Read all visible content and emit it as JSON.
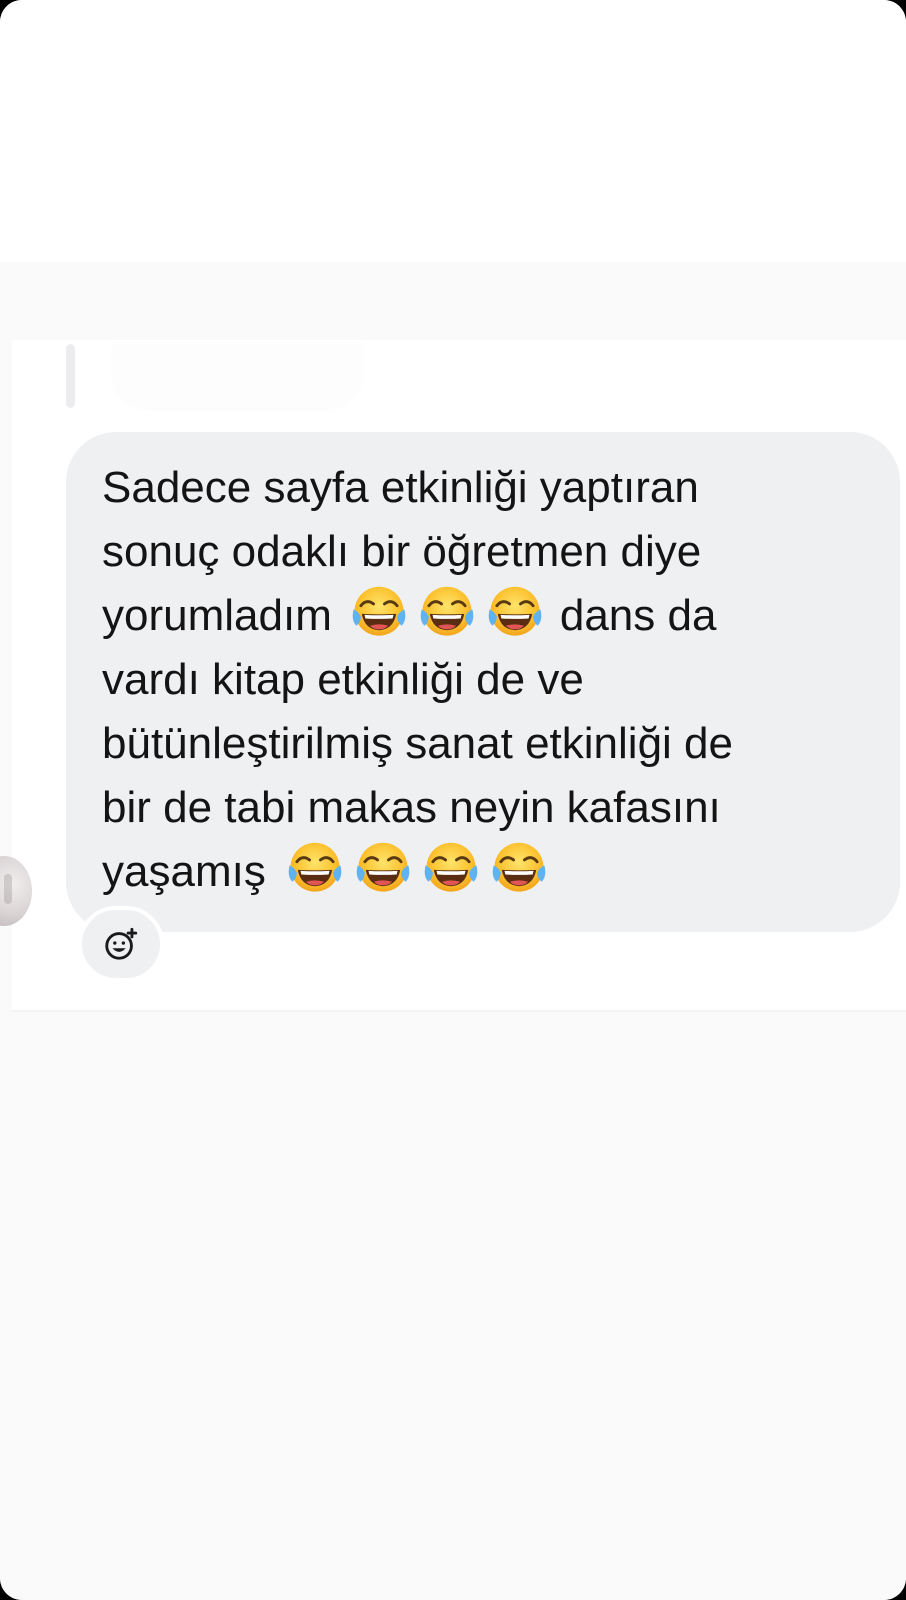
{
  "message": {
    "lines": [
      {
        "text": "Sadece sayfa etkinliği yaptıran",
        "emojis_after": []
      },
      {
        "text": "sonuç odaklı bir öğretmen diye",
        "emojis_after": []
      },
      {
        "text": "yorumladım",
        "emojis_after": [
          "face-with-tears-of-joy-emoji",
          "face-with-tears-of-joy-emoji",
          "face-with-tears-of-joy-emoji"
        ],
        "text_after": "dans da"
      },
      {
        "text": "vardı kitap etkinliği de ve",
        "emojis_after": []
      },
      {
        "text": "bütünleştirilmiş sanat etkinliği de",
        "emojis_after": []
      },
      {
        "text": "bir de tabi makas neyin kafasını",
        "emojis_after": []
      },
      {
        "text": "yaşamış",
        "emojis_after": [
          "face-with-tears-of-joy-emoji",
          "face-with-tears-of-joy-emoji",
          "face-with-tears-of-joy-emoji",
          "face-with-tears-of-joy-emoji"
        ]
      }
    ]
  },
  "reaction_button": {
    "icon": "add-reaction-icon"
  },
  "colors": {
    "bubble_background": "#eff0f2",
    "text": "#141414",
    "page_background": "#fafafa",
    "chat_background": "#ffffff"
  }
}
